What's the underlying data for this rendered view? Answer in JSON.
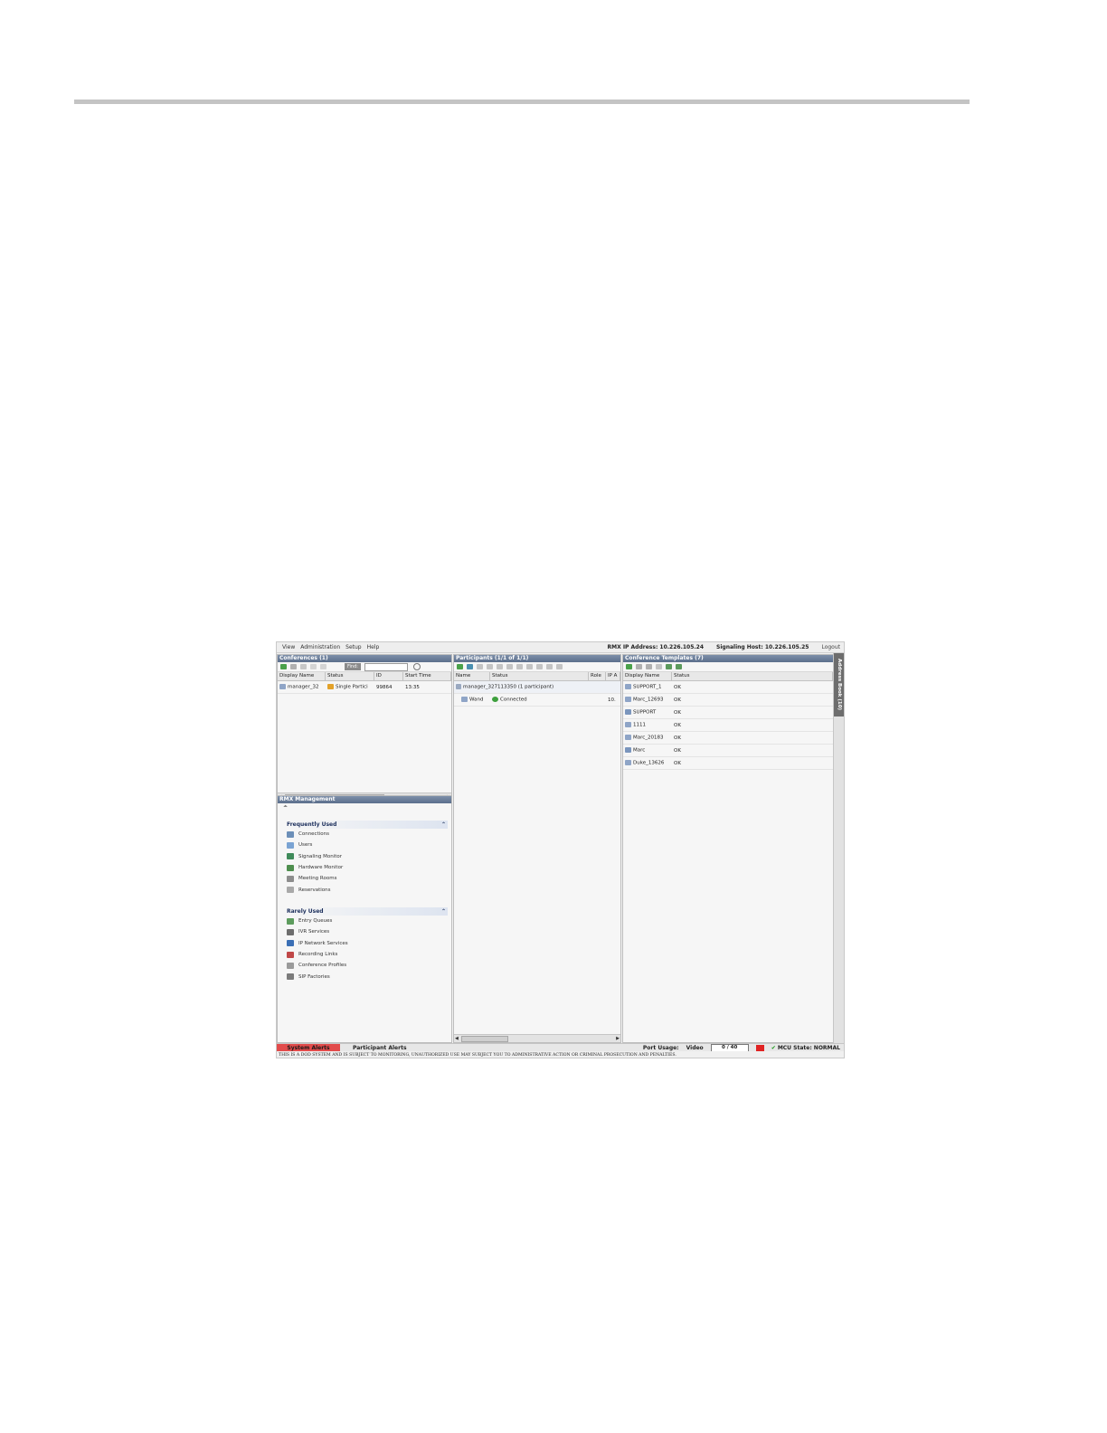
{
  "menu": {
    "items": [
      "View",
      "Administration",
      "Setup",
      "Help"
    ],
    "rmx_ip": "RMX IP Address: 10.226.105.24",
    "signaling_host": "Signaling Host: 10.226.105.25",
    "logout": "Logout"
  },
  "conferences": {
    "title": "Conferences (1)",
    "find_label": "Find:",
    "find_value": "",
    "columns": [
      "Display Name",
      "Status",
      "ID",
      "Start Time"
    ],
    "rows": [
      {
        "name": "manager_32",
        "status": "Single Partici",
        "id": "99864",
        "start": "13:35"
      }
    ]
  },
  "participants": {
    "title": "Participants (1/1 of 1/1)",
    "columns": [
      "Name",
      "Status",
      "Role",
      "IP A"
    ],
    "group": "manager_327113350 (1 participant)",
    "rows": [
      {
        "name": "Wand",
        "status": "Connected",
        "ip": "10."
      }
    ]
  },
  "templates": {
    "title": "Conference Templates (7)",
    "columns": [
      "Display Name",
      "Status"
    ],
    "rows": [
      {
        "name": "SUPPORT_1",
        "status": "OK"
      },
      {
        "name": "Marc_12693",
        "status": "OK"
      },
      {
        "name": "SUPPORT",
        "status": "OK"
      },
      {
        "name": "1111",
        "status": "OK"
      },
      {
        "name": "Marc_20183",
        "status": "OK"
      },
      {
        "name": "Marc",
        "status": "OK"
      },
      {
        "name": "Duke_13626",
        "status": "OK"
      }
    ]
  },
  "address_book": "Address Book (10)",
  "management": {
    "title": "RMX Management",
    "frequent": {
      "label": "Frequently Used",
      "items": [
        "Connections",
        "Users",
        "Signaling Monitor",
        "Hardware Monitor",
        "Meeting Rooms",
        "Reservations"
      ]
    },
    "rare": {
      "label": "Rarely Used",
      "items": [
        "Entry Queues",
        "IVR Services",
        "IP Network Services",
        "Recording Links",
        "Conference Profiles",
        "SIP Factories"
      ]
    }
  },
  "status_bar": {
    "system_alerts": "System Alerts",
    "participant_alerts": "Participant Alerts",
    "port_usage": "Port Usage:",
    "port_type": "Video",
    "port_value": "0 / 40",
    "mcu_state": "MCU State: NORMAL",
    "banner": "THIS IS A DOD SYSTEM AND IS SUBJECT TO MONITORING, UNAUTHORIZED USE MAY SUBJECT YOU TO ADMINISTRATIVE ACTION OR CRIMINAL PROSECUTION AND PENALTIES."
  },
  "colors": {
    "title_bar": "#5c6f8c",
    "alert_red": "#e24b4b",
    "ok_green": "#1a9a1a"
  }
}
